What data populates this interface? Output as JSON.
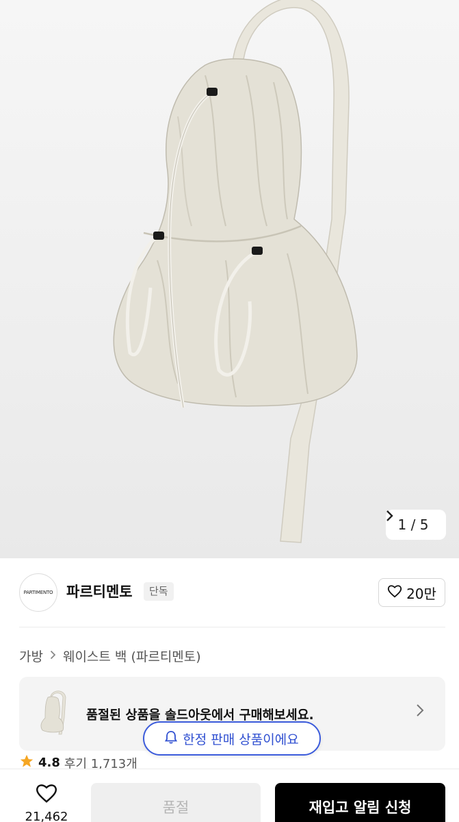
{
  "gallery": {
    "counter": "1 / 5",
    "next_icon": "chevron-right-icon"
  },
  "brand": {
    "logo_text": "PARTIMENTO",
    "name": "파르티멘토",
    "tag": "단독",
    "like_count": "20만"
  },
  "breadcrumb": {
    "category": "가방",
    "subcategory": "웨이스트 백 (파르티멘토)"
  },
  "soldout_banner": {
    "message": "품절된 상품을 솔드아웃에서 구매해보세요."
  },
  "limited_notice": {
    "label": "한정 판매 상품이에요"
  },
  "rating": {
    "score": "4.8",
    "review_label": "후기 1,713개"
  },
  "bottom_bar": {
    "wish_count": "21,462",
    "soldout_label": "품절",
    "restock_label": "재입고 알림 신청"
  },
  "colors": {
    "accent_blue": "#3b5bdb",
    "star": "#f5a623",
    "bag": "#e4e1d6"
  }
}
